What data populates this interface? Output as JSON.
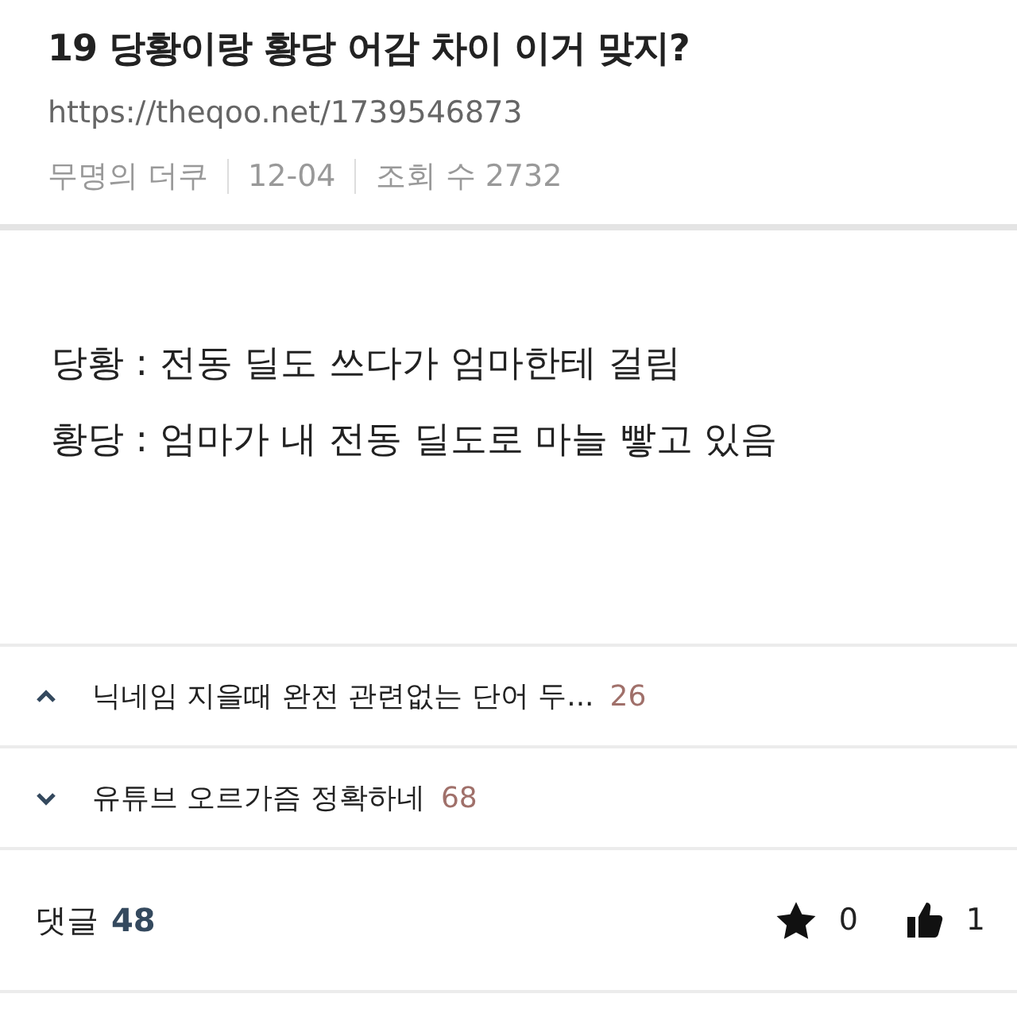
{
  "post": {
    "title": "19 당황이랑 황당 어감 차이 이거 맞지?",
    "url": "https://theqoo.net/1739546873",
    "author": "무명의 더쿠",
    "date": "12-04",
    "views_label": "조회 수",
    "views": "2732"
  },
  "body": [
    "당황 : 전동 딜도 쓰다가 엄마한테 걸림",
    "황당 : 엄마가 내 전동 딜도로 마늘 빻고 있음"
  ],
  "nav": [
    {
      "kind": "prev",
      "title": "닉네임 지을때 완전 관련없는 단어 두...",
      "comments": "26"
    },
    {
      "kind": "next",
      "title": "유튜브 오르가즘 정확하네",
      "comments": "68"
    }
  ],
  "footer": {
    "comments_label": "댓글",
    "comments": "48",
    "stars": "0",
    "likes": "1"
  }
}
